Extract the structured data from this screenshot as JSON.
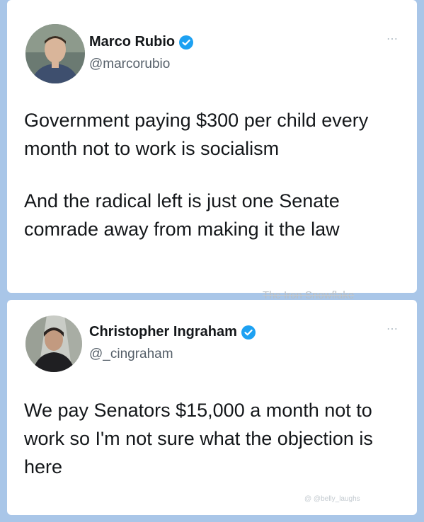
{
  "tweets": [
    {
      "author_name": "Marco Rubio",
      "handle": "@marcorubio",
      "verified": true,
      "more_icon": "⋯",
      "paragraphs": [
        "Government paying $300 per child every month not to work is socialism",
        "And the radical left is just one Senate comrade away from making it the law"
      ]
    },
    {
      "author_name": "Christopher Ingraham",
      "handle": "@_cingraham",
      "verified": true,
      "more_icon": "⋯",
      "paragraphs": [
        "We pay Senators $15,000 a month not to work so I'm not sure what the objection is here"
      ]
    }
  ],
  "watermarks": {
    "main": "The Iron Snowflake",
    "corner": "@ @belly_laughs"
  },
  "colors": {
    "background": "#a9c6e8",
    "card": "#ffffff",
    "text": "#14171a",
    "handle": "#555f69",
    "verified": "#1da1f2"
  },
  "icons": {
    "verified": "verified-badge-icon",
    "more": "more-options-icon"
  }
}
